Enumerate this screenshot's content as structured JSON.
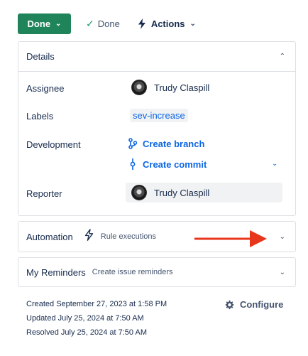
{
  "toolbar": {
    "status_label": "Done",
    "resolution_label": "Done",
    "actions_label": "Actions"
  },
  "details": {
    "title": "Details",
    "assignee_label": "Assignee",
    "assignee_name": "Trudy Claspill",
    "labels_label": "Labels",
    "label_value": "sev-increase",
    "development_label": "Development",
    "create_branch": "Create branch",
    "create_commit": "Create commit",
    "reporter_label": "Reporter",
    "reporter_name": "Trudy Claspill"
  },
  "automation": {
    "title": "Automation",
    "subtitle": "Rule executions"
  },
  "reminders": {
    "title": "My Reminders",
    "subtitle": "Create issue reminders"
  },
  "meta": {
    "created": "Created September 27, 2023 at 1:58 PM",
    "updated": "Updated July 25, 2024 at 7:50 AM",
    "resolved": "Resolved July 25, 2024 at 7:50 AM",
    "configure_label": "Configure"
  },
  "colors": {
    "status_green": "#1f845a",
    "link_blue": "#0c66e4",
    "annotation_arrow": "#e8361c"
  }
}
